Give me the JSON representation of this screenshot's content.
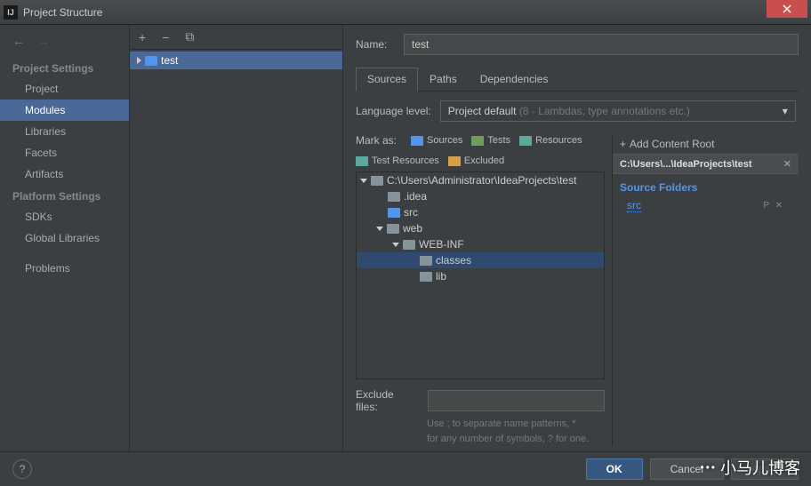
{
  "window": {
    "title": "Project Structure"
  },
  "sidebar": {
    "heading1": "Project Settings",
    "items1": [
      "Project",
      "Modules",
      "Libraries",
      "Facets",
      "Artifacts"
    ],
    "selected1": 1,
    "heading2": "Platform Settings",
    "items2": [
      "SDKs",
      "Global Libraries"
    ],
    "heading3": "",
    "items3": [
      "Problems"
    ]
  },
  "modules": {
    "items": [
      "test"
    ]
  },
  "details": {
    "name_label": "Name:",
    "name_value": "test",
    "tabs": [
      "Sources",
      "Paths",
      "Dependencies"
    ],
    "active_tab": 0,
    "lang_label": "Language level:",
    "lang_value": "Project default",
    "lang_suffix": "(8 - Lambdas, type annotations etc.)",
    "mark_label": "Mark as:",
    "marks": [
      {
        "label": "Sources",
        "color": "blue"
      },
      {
        "label": "Tests",
        "color": "green"
      },
      {
        "label": "Resources",
        "color": "teal"
      },
      {
        "label": "Test Resources",
        "color": "teal"
      },
      {
        "label": "Excluded",
        "color": "orange"
      }
    ],
    "tree": [
      {
        "label": "C:\\Users\\Administrator\\IdeaProjects\\test",
        "depth": 0,
        "expanded": true,
        "folder": "plain"
      },
      {
        "label": ".idea",
        "depth": 1,
        "expanded": false,
        "folder": "plain"
      },
      {
        "label": "src",
        "depth": 1,
        "expanded": false,
        "folder": "blue"
      },
      {
        "label": "web",
        "depth": 1,
        "expanded": true,
        "folder": "plain"
      },
      {
        "label": "WEB-INF",
        "depth": 2,
        "expanded": true,
        "folder": "plain"
      },
      {
        "label": "classes",
        "depth": 3,
        "expanded": false,
        "folder": "plain",
        "selected": true
      },
      {
        "label": "lib",
        "depth": 3,
        "expanded": false,
        "folder": "plain"
      }
    ],
    "add_root": "Add Content Root",
    "root_path": "C:\\Users\\...\\IdeaProjects\\test",
    "source_folders_h": "Source Folders",
    "source_folders": [
      "src"
    ],
    "exclude_label": "Exclude files:",
    "exclude_hint1": "Use ; to separate name patterns, *",
    "exclude_hint2": "for any number of symbols, ? for one."
  },
  "footer": {
    "ok": "OK",
    "cancel": "Cancel",
    "apply": "Apply"
  },
  "watermark": "小马儿博客"
}
